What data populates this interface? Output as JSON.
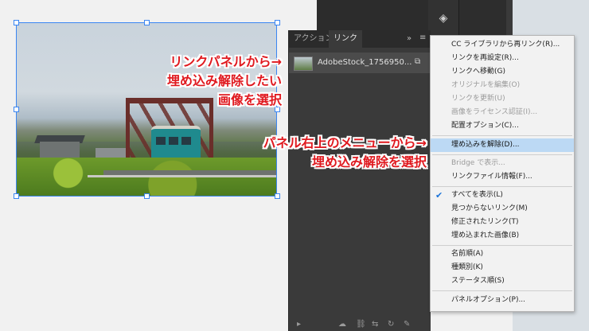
{
  "panel": {
    "tabs": [
      {
        "label": "アクション"
      },
      {
        "label": "リンク"
      }
    ],
    "more_label": "»",
    "link_item": {
      "name": "AdobeStock_1756950..."
    }
  },
  "menu": {
    "items": [
      {
        "label": "CC ライブラリから再リンク(R)...",
        "disabled": false
      },
      {
        "label": "リンクを再設定(R)...",
        "disabled": false
      },
      {
        "label": "リンクへ移動(G)",
        "disabled": false
      },
      {
        "label": "オリジナルを編集(O)",
        "disabled": true
      },
      {
        "label": "リンクを更新(U)",
        "disabled": true
      },
      {
        "label": "画像をライセンス認証(I)...",
        "disabled": true
      },
      {
        "label": "配置オプション(C)...",
        "disabled": false
      },
      {
        "label": "埋め込みを解除(D)...",
        "disabled": false,
        "highlighted": true
      },
      {
        "label": "Bridge で表示...",
        "disabled": true
      },
      {
        "label": "リンクファイル情報(F)...",
        "disabled": false
      },
      {
        "label": "すべてを表示(L)",
        "disabled": false,
        "checked": true
      },
      {
        "label": "見つからないリンク(M)",
        "disabled": false
      },
      {
        "label": "修正されたリンク(T)",
        "disabled": false
      },
      {
        "label": "埋め込まれた画像(B)",
        "disabled": false
      },
      {
        "label": "名前順(A)",
        "disabled": false
      },
      {
        "label": "種類別(K)",
        "disabled": false
      },
      {
        "label": "ステータス順(S)",
        "disabled": false
      },
      {
        "label": "パネルオプション(P)...",
        "disabled": false
      }
    ]
  },
  "annotations": {
    "a1": "リンクパネルから→\n埋め込み解除したい\n画像を選択",
    "a1_lines": [
      "リンクパネルから→",
      "埋め込み解除したい",
      "画像を選択"
    ],
    "a2_lines": [
      "パネル右上のメニューから→",
      "埋め込み解除を選択"
    ]
  },
  "colors": {
    "annotation": "#e0191f",
    "menu_highlight": "#bcd9f4",
    "selection": "#3b86f2"
  }
}
